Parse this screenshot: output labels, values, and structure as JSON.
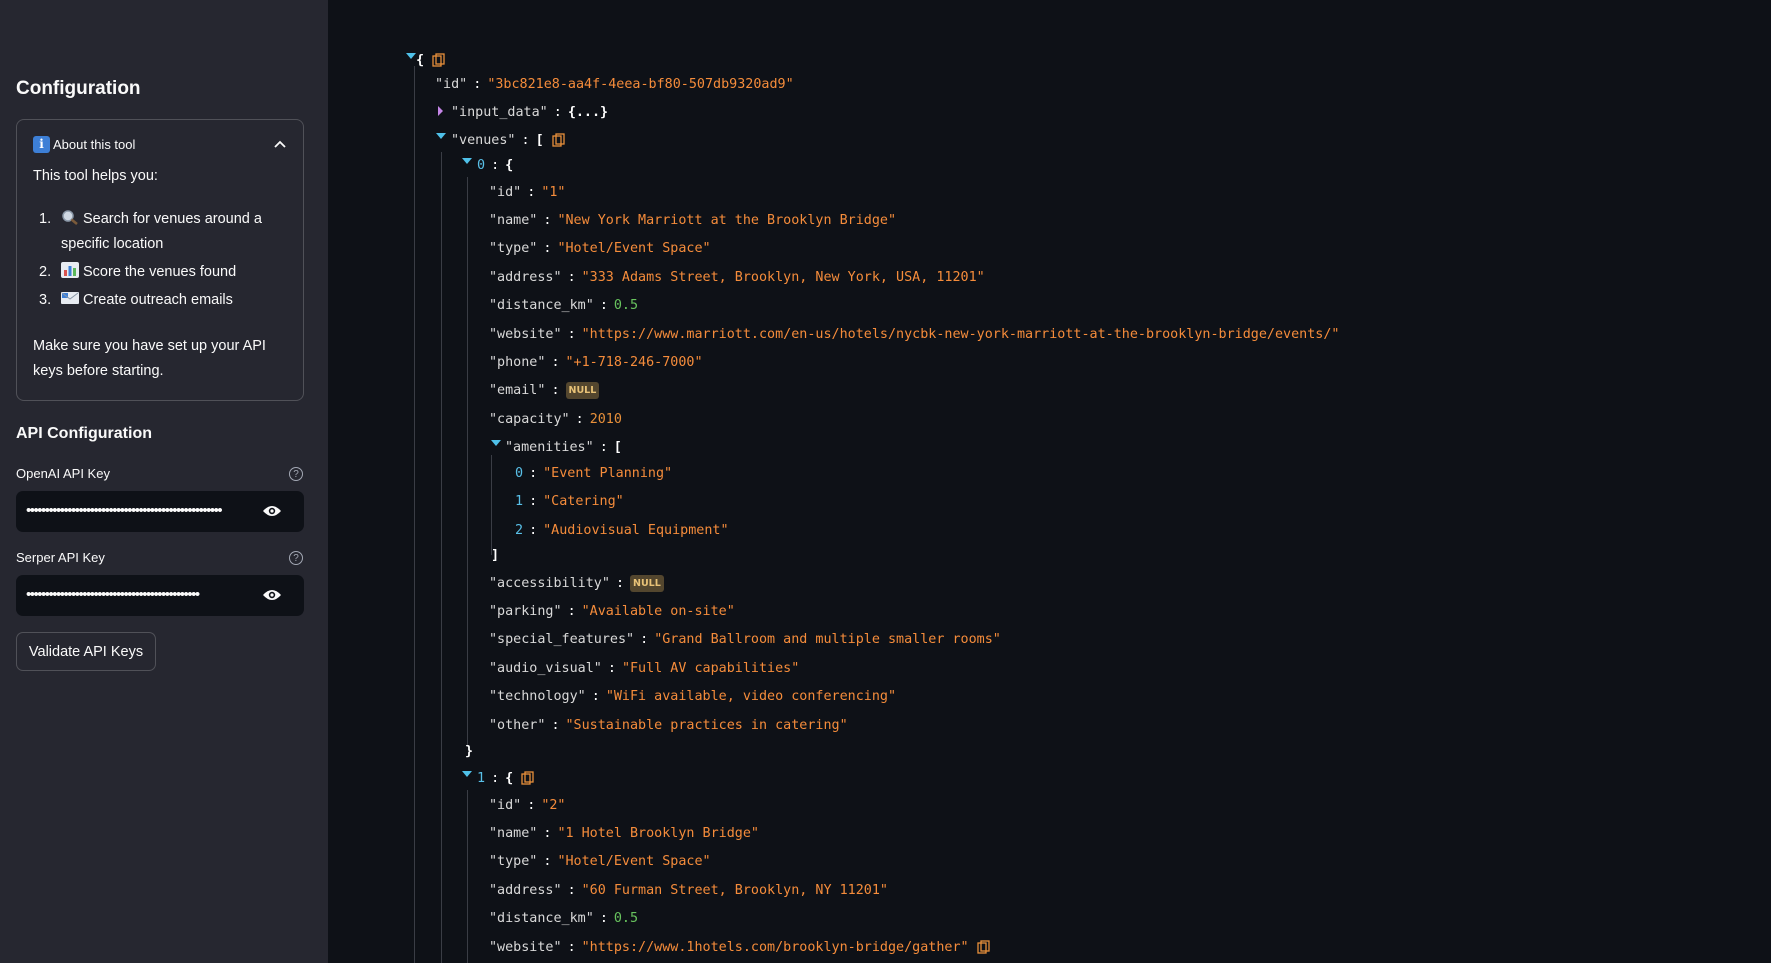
{
  "sidebar": {
    "title": "Configuration",
    "about": {
      "title": "About this tool",
      "intro": "This tool helps you:",
      "items": [
        {
          "num": "1.",
          "text": "Search for venues around a specific location",
          "icon": "magnifier-icon"
        },
        {
          "num": "2.",
          "text": "Score the venues found",
          "icon": "bar-chart-icon"
        },
        {
          "num": "3.",
          "text": "Create outreach emails",
          "icon": "email-icon"
        }
      ],
      "note": "Make sure you have set up your API keys before starting."
    },
    "api_title": "API Configuration",
    "openai_label": "OpenAI API Key",
    "openai_value": "••••••••••••••••••••••••••••••••••••••••••••••••••••",
    "serper_label": "Serper API Key",
    "serper_value": "••••••••••••••••••••••••••••••••••••••••••••••",
    "validate_label": "Validate API Keys"
  },
  "json": {
    "root_open": "{",
    "id_key": "\"id\"",
    "id_val": "\"3bc821e8-aa4f-4eea-bf80-507db9320ad9\"",
    "input_key": "\"input_data\"",
    "input_collapsed": "{...}",
    "venues_key": "\"venues\"",
    "venues_open": "[",
    "venue0": {
      "index": "0",
      "id": "\"1\"",
      "name": "\"New York Marriott at the Brooklyn Bridge\"",
      "type": "\"Hotel/Event Space\"",
      "address": "\"333 Adams Street, Brooklyn, New York, USA, 11201\"",
      "distance_km": "0.5",
      "website": "\"https://www.marriott.com/en-us/hotels/nycbk-new-york-marriott-at-the-brooklyn-bridge/events/\"",
      "phone": "\"+1-718-246-7000\"",
      "email": "NULL",
      "capacity": "2010",
      "amenities": [
        "\"Event Planning\"",
        "\"Catering\"",
        "\"Audiovisual Equipment\""
      ],
      "accessibility": "NULL",
      "parking": "\"Available on-site\"",
      "special_features": "\"Grand Ballroom and multiple smaller rooms\"",
      "audio_visual": "\"Full AV capabilities\"",
      "technology": "\"WiFi available, video conferencing\"",
      "other": "\"Sustainable practices in catering\""
    },
    "venue1": {
      "index": "1",
      "id": "\"2\"",
      "name": "\"1 Hotel Brooklyn Bridge\"",
      "type": "\"Hotel/Event Space\"",
      "address": "\"60 Furman Street, Brooklyn, NY 11201\"",
      "distance_km": "0.5",
      "website": "\"https://www.1hotels.com/brooklyn-bridge/gather\""
    },
    "keys": {
      "id": "\"id\"",
      "name": "\"name\"",
      "type": "\"type\"",
      "address": "\"address\"",
      "distance_km": "\"distance_km\"",
      "website": "\"website\"",
      "phone": "\"phone\"",
      "email": "\"email\"",
      "capacity": "\"capacity\"",
      "amenities": "\"amenities\"",
      "accessibility": "\"accessibility\"",
      "parking": "\"parking\"",
      "special_features": "\"special_features\"",
      "audio_visual": "\"audio_visual\"",
      "technology": "\"technology\"",
      "other": "\"other\""
    },
    "amen_idx": [
      "0",
      "1",
      "2"
    ],
    "colon": ":",
    "open_brace": "{",
    "close_brace": "}",
    "open_bracket": "[",
    "close_bracket": "]"
  },
  "colors": {
    "sidebar_bg": "#262730",
    "main_bg": "#0e1117",
    "string": "#f58c3b",
    "number": "#68c35e",
    "index": "#59c0e8"
  }
}
